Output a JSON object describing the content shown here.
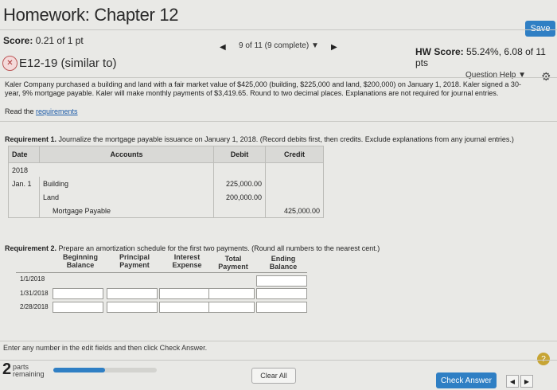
{
  "header": {
    "title": "Homework: Chapter 12",
    "save_label": "Save",
    "score_label": "Score:",
    "score_value": "0.21 of 1 pt",
    "nav_count": "9 of 11 (9 complete)",
    "hw_score_label": "HW Score:",
    "hw_score_value": "55.24%, 6.08 of 11 pts"
  },
  "question": {
    "id": "E12-19 (similar to)",
    "help_label": "Question Help",
    "text": "Kaler Company purchased a building and land with a fair market value of $425,000 (building, $225,000 and land, $200,000) on January 1, 2018. Kaler signed a 30-year, 9% mortgage payable. Kaler will make monthly payments of $3,419.65. Round to two decimal places. Explanations are not required for journal entries.",
    "read_prefix": "Read the ",
    "read_link": "requirements"
  },
  "requirement1": {
    "label": "Requirement 1.",
    "text": " Journalize the mortgage payable issuance on January 1, 2018. (Record debits first, then credits. Exclude explanations from any journal entries.)",
    "columns": {
      "date": "Date",
      "accounts": "Accounts",
      "debit": "Debit",
      "credit": "Credit"
    },
    "year": "2018",
    "date": "Jan. 1",
    "rows": [
      {
        "account": "Building",
        "debit": "225,000.00",
        "credit": ""
      },
      {
        "account": "Land",
        "debit": "200,000.00",
        "credit": ""
      },
      {
        "account": "Mortgage Payable",
        "debit": "",
        "credit": "425,000.00"
      }
    ]
  },
  "requirement2": {
    "label": "Requirement 2.",
    "text": " Prepare an amortization schedule for the first two payments. (Round all numbers to the nearest cent.)",
    "headers": [
      "Beginning Balance",
      "Principal Payment",
      "Interest Expense",
      "Total Payment",
      "Ending Balance"
    ],
    "dates": [
      "1/1/2018",
      "1/31/2018",
      "2/28/2018"
    ]
  },
  "footer": {
    "hint": "Enter any number in the edit fields and then click Check Answer.",
    "parts_num": "2",
    "parts_text1": "parts",
    "parts_text2": "remaining",
    "progress_fraction": 0.5,
    "clear_label": "Clear All",
    "check_label": "Check Answer"
  },
  "colors": {
    "accent": "#2f7fc4",
    "help_badge": "#c7a534",
    "incorrect": "#a33"
  },
  "icons": [
    "incorrect-x-icon",
    "caret-left-icon",
    "caret-right-icon",
    "dropdown-caret-icon",
    "gear-icon",
    "help-question-icon"
  ]
}
